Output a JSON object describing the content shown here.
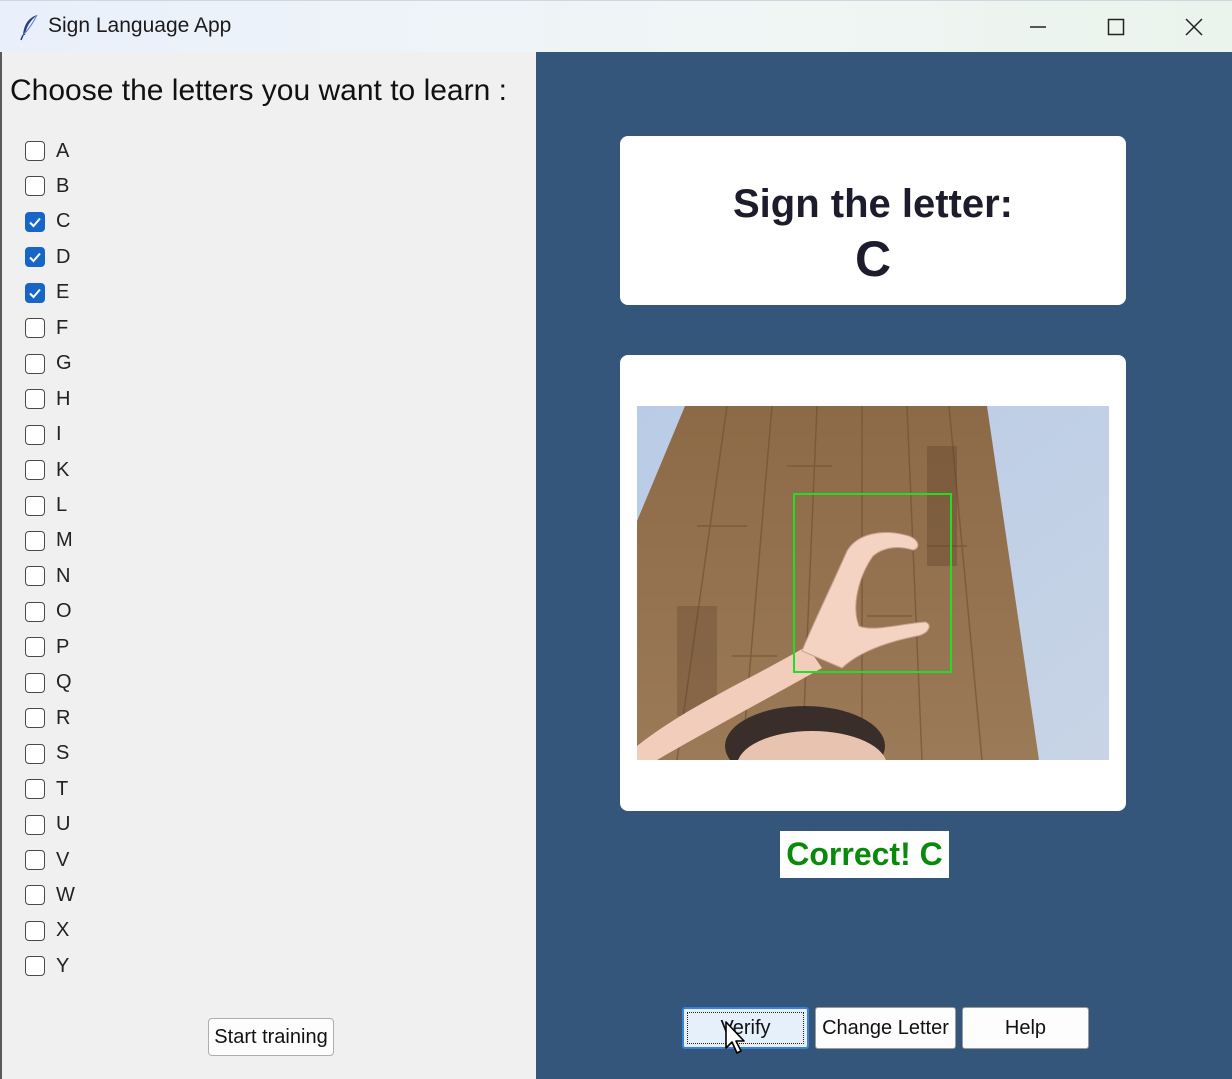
{
  "window": {
    "title": "Sign Language App",
    "controls": [
      "minimize-icon",
      "maximize-icon",
      "close-icon"
    ]
  },
  "left_panel": {
    "heading": "Choose the letters you want to learn :",
    "letters": [
      {
        "label": "A",
        "checked": false
      },
      {
        "label": "B",
        "checked": false
      },
      {
        "label": "C",
        "checked": true
      },
      {
        "label": "D",
        "checked": true
      },
      {
        "label": "E",
        "checked": true
      },
      {
        "label": "F",
        "checked": false
      },
      {
        "label": "G",
        "checked": false
      },
      {
        "label": "H",
        "checked": false
      },
      {
        "label": "I",
        "checked": false
      },
      {
        "label": "K",
        "checked": false
      },
      {
        "label": "L",
        "checked": false
      },
      {
        "label": "M",
        "checked": false
      },
      {
        "label": "N",
        "checked": false
      },
      {
        "label": "O",
        "checked": false
      },
      {
        "label": "P",
        "checked": false
      },
      {
        "label": "Q",
        "checked": false
      },
      {
        "label": "R",
        "checked": false
      },
      {
        "label": "S",
        "checked": false
      },
      {
        "label": "T",
        "checked": false
      },
      {
        "label": "U",
        "checked": false
      },
      {
        "label": "V",
        "checked": false
      },
      {
        "label": "W",
        "checked": false
      },
      {
        "label": "X",
        "checked": false
      },
      {
        "label": "Y",
        "checked": false
      }
    ],
    "start_button": "Start training"
  },
  "right_panel": {
    "prompt_title": "Sign the letter:",
    "prompt_letter": "C",
    "camera_feed": "webcam-hand-sign-image",
    "result_text": "Correct! C",
    "buttons": {
      "verify": "Verify",
      "change_letter": "Change Letter",
      "help": "Help"
    }
  },
  "colors": {
    "right_bg": "#34567b",
    "checkbox_checked": "#1766c7",
    "result_text": "#0a8a0a",
    "detection_box": "#22dd22"
  }
}
